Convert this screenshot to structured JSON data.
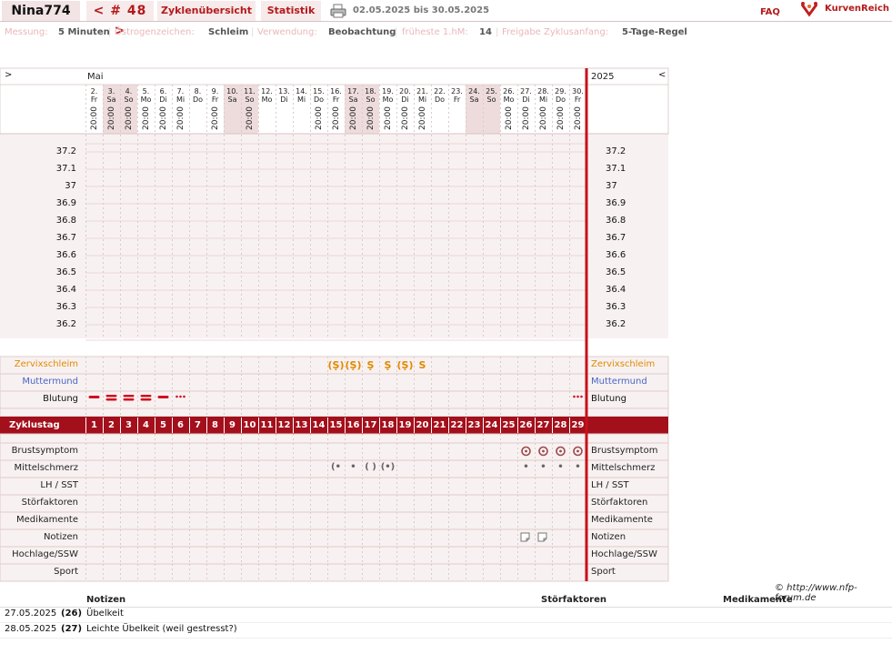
{
  "header": {
    "username": "Nina774",
    "cycle_nav": "< # 48 >",
    "tab_overview": "Zyklenübersicht",
    "tab_stats": "Statistik",
    "date_range": "02.05.2025 bis 30.05.2025",
    "faq": "FAQ",
    "logo_text": "KurvenReich"
  },
  "settings": [
    {
      "label": "Messung:",
      "value": "5 Minuten"
    },
    {
      "label": "Östrogenzeichen:",
      "value": "Schleim"
    },
    {
      "label": "Verwendung:",
      "value": "Beobachtung"
    },
    {
      "label": "früheste 1.hM:",
      "value": "14"
    },
    {
      "label": "Freigabe Zyklusanfang:",
      "value": "5-Tage-Regel"
    }
  ],
  "nav": {
    "prev": ">",
    "next": "<"
  },
  "month": "Mai",
  "year": "2025",
  "days": [
    {
      "date": "2.",
      "wd": "Fr",
      "time": "20:00",
      "we": false
    },
    {
      "date": "3.",
      "wd": "Sa",
      "time": "20:00",
      "we": true
    },
    {
      "date": "4.",
      "wd": "So",
      "time": "20:00",
      "we": true
    },
    {
      "date": "5.",
      "wd": "Mo",
      "time": "20:00",
      "we": false
    },
    {
      "date": "6.",
      "wd": "Di",
      "time": "20:00",
      "we": false
    },
    {
      "date": "7.",
      "wd": "Mi",
      "time": "20:00",
      "we": false
    },
    {
      "date": "8.",
      "wd": "Do",
      "time": "",
      "we": false
    },
    {
      "date": "9.",
      "wd": "Fr",
      "time": "20:00",
      "we": false
    },
    {
      "date": "10.",
      "wd": "Sa",
      "time": "",
      "we": true
    },
    {
      "date": "11.",
      "wd": "So",
      "time": "20:00",
      "we": true
    },
    {
      "date": "12.",
      "wd": "Mo",
      "time": "",
      "we": false
    },
    {
      "date": "13.",
      "wd": "Di",
      "time": "",
      "we": false
    },
    {
      "date": "14.",
      "wd": "Mi",
      "time": "",
      "we": false
    },
    {
      "date": "15.",
      "wd": "Do",
      "time": "20:00",
      "we": false
    },
    {
      "date": "16.",
      "wd": "Fr",
      "time": "20:00",
      "we": false
    },
    {
      "date": "17.",
      "wd": "Sa",
      "time": "20:00",
      "we": true
    },
    {
      "date": "18.",
      "wd": "So",
      "time": "20:00",
      "we": true
    },
    {
      "date": "19.",
      "wd": "Mo",
      "time": "20:00",
      "we": false
    },
    {
      "date": "20.",
      "wd": "Di",
      "time": "20:00",
      "we": false
    },
    {
      "date": "21.",
      "wd": "Mi",
      "time": "20:00",
      "we": false
    },
    {
      "date": "22.",
      "wd": "Do",
      "time": "",
      "we": false
    },
    {
      "date": "23.",
      "wd": "Fr",
      "time": "",
      "we": false
    },
    {
      "date": "24.",
      "wd": "Sa",
      "time": "",
      "we": true
    },
    {
      "date": "25.",
      "wd": "So",
      "time": "",
      "we": true
    },
    {
      "date": "26.",
      "wd": "Mo",
      "time": "20:00",
      "we": false
    },
    {
      "date": "27.",
      "wd": "Di",
      "time": "20:00",
      "we": false
    },
    {
      "date": "28.",
      "wd": "Mi",
      "time": "20:00",
      "we": false
    },
    {
      "date": "29.",
      "wd": "Do",
      "time": "20:00",
      "we": false
    },
    {
      "date": "30.",
      "wd": "Fr",
      "time": "20:00",
      "we": false
    }
  ],
  "temps": [
    "37.2",
    "37.1",
    "37",
    "36.9",
    "36.8",
    "36.7",
    "36.6",
    "36.5",
    "36.4",
    "36.3",
    "36.2"
  ],
  "rows_top": [
    {
      "label": "Zervixschleim",
      "color": "#e08a00"
    },
    {
      "label": "Muttermund",
      "color": "#4a66c4"
    },
    {
      "label": "Blutung",
      "color": "#111111"
    }
  ],
  "cycle_label": "Zyklustag",
  "rows_bottom": [
    "Brustsymptom",
    "Mittelschmerz",
    "LH / SST",
    "Störfaktoren",
    "Medikamente",
    "Notizen",
    "Hochlage/SSW",
    "Sport"
  ],
  "mucus": [
    {
      "day": 15,
      "sym": "(Ṣ)"
    },
    {
      "day": 16,
      "sym": "(Ṣ)"
    },
    {
      "day": 17,
      "sym": "Ṣ"
    },
    {
      "day": 18,
      "sym": "Ṣ"
    },
    {
      "day": 19,
      "sym": "(Ṣ)"
    },
    {
      "day": 20,
      "sym": "S"
    }
  ],
  "bleeding": [
    {
      "day": 1,
      "level": "light"
    },
    {
      "day": 2,
      "level": "strong"
    },
    {
      "day": 3,
      "level": "strong"
    },
    {
      "day": 4,
      "level": "strong"
    },
    {
      "day": 5,
      "level": "light"
    },
    {
      "day": 6,
      "level": "spotting"
    },
    {
      "day": 29,
      "level": "spotting"
    }
  ],
  "breast": [
    26,
    27,
    28,
    29
  ],
  "mittelschmerz": [
    {
      "day": 15,
      "sym": "(•"
    },
    {
      "day": 16,
      "sym": "•"
    },
    {
      "day": 17,
      "sym": "( )"
    },
    {
      "day": 18,
      "sym": "(•)"
    },
    {
      "day": 26,
      "sym": "•"
    },
    {
      "day": 27,
      "sym": "•"
    },
    {
      "day": 28,
      "sym": "•"
    },
    {
      "day": 29,
      "sym": "•"
    }
  ],
  "notes_icons": [
    26,
    27
  ],
  "copyright": "© http://www.nfp-forum.de",
  "notes_table": {
    "headers": [
      "Notizen",
      "Störfaktoren",
      "Medikamente"
    ],
    "rows": [
      {
        "date": "27.05.2025",
        "day": "(26)",
        "text": "Übelkeit"
      },
      {
        "date": "28.05.2025",
        "day": "(27)",
        "text": "Leichte Übelkeit (weil gestresst?)"
      }
    ]
  },
  "colors": {
    "accent": "#b5191b",
    "cycle_bar": "#a30f1b",
    "grid_bg": "#f8f1f1",
    "weekend": "#eedcdc",
    "mucus": "#e08a00",
    "muttermund": "#4a66c4"
  }
}
